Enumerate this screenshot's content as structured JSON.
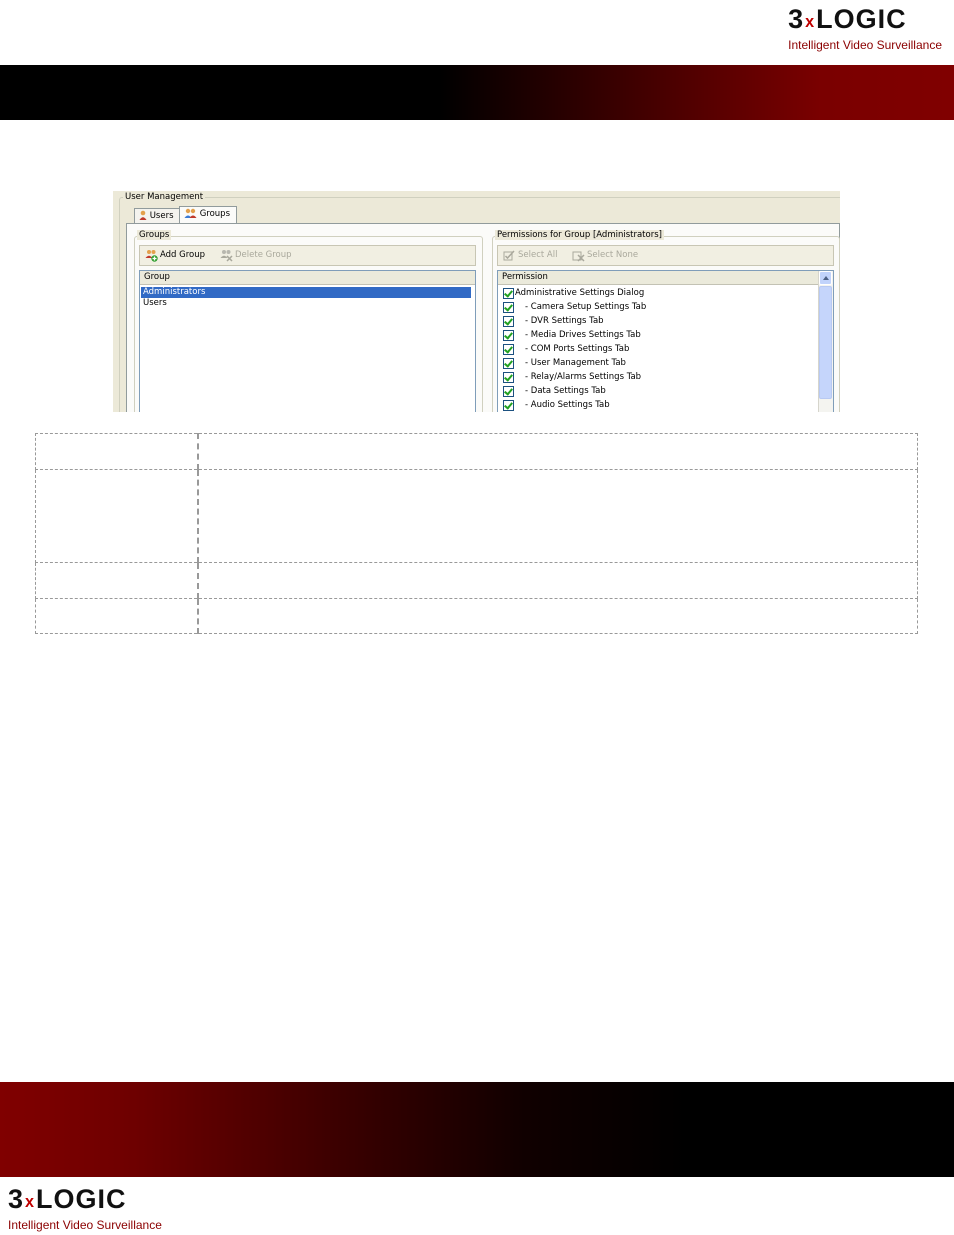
{
  "header": {
    "logo_prefix": "3",
    "logo_x": "x",
    "logo_suffix": "LOGIC",
    "tagline": "Intelligent Video Surveillance"
  },
  "screenshot": {
    "title": "User Management",
    "tabs": [
      {
        "label": "Users",
        "icon": "user-icon",
        "active": false
      },
      {
        "label": "Groups",
        "icon": "group-icon",
        "active": true
      }
    ],
    "groups_panel": {
      "legend": "Groups",
      "toolbar": {
        "add_label": "Add Group",
        "delete_label": "Delete Group"
      },
      "column_header": "Group",
      "rows": [
        {
          "label": "Administrators",
          "selected": true
        },
        {
          "label": "Users",
          "selected": false
        }
      ]
    },
    "permissions_panel": {
      "legend": "Permissions for Group [Administrators]",
      "toolbar": {
        "select_all_label": "Select All",
        "select_none_label": "Select None"
      },
      "column_header": "Permission",
      "items": [
        {
          "label": "Administrative Settings Dialog",
          "checked": true,
          "child": false
        },
        {
          "label": "- Camera Setup Settings Tab",
          "checked": true,
          "child": true
        },
        {
          "label": "- DVR Settings Tab",
          "checked": true,
          "child": true
        },
        {
          "label": "- Media Drives Settings Tab",
          "checked": true,
          "child": true
        },
        {
          "label": "- COM Ports Settings Tab",
          "checked": true,
          "child": true
        },
        {
          "label": "- User Management Tab",
          "checked": true,
          "child": true
        },
        {
          "label": "- Relay/Alarms Settings Tab",
          "checked": true,
          "child": true
        },
        {
          "label": "- Data Settings Tab",
          "checked": true,
          "child": true
        },
        {
          "label": "- Audio Settings Tab",
          "checked": true,
          "child": true
        }
      ]
    }
  },
  "table": {
    "rows": [
      {
        "c1": "",
        "c2": ""
      },
      {
        "c1": "",
        "c2": ""
      },
      {
        "c1": "",
        "c2": ""
      },
      {
        "c1": "",
        "c2": ""
      }
    ]
  },
  "colors": {
    "brand_red": "#8b0000",
    "selection": "#316ac5"
  }
}
